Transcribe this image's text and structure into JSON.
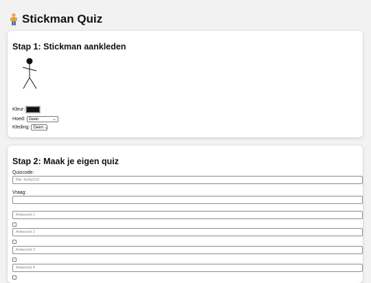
{
  "header": {
    "title": "Stickman Quiz",
    "icon": "person-icon"
  },
  "step1": {
    "title": "Stap 1: Stickman aankleden",
    "color_label": "Kleur:",
    "color_value": "#111111",
    "hat_label": "Hoed:",
    "hat_value": "Geen",
    "clothing_label": "Kleding:",
    "clothing_value": "Geen"
  },
  "step2": {
    "title": "Stap 2: Maak je eigen quiz",
    "quizcode_label": "Quizcode:",
    "quizcode_placeholder": "Bijv. bonty123",
    "question_label": "Vraag:",
    "question_placeholder": "",
    "answers": [
      {
        "placeholder": "Antwoord 1"
      },
      {
        "placeholder": "Antwoord 2"
      },
      {
        "placeholder": "Antwoord 3"
      },
      {
        "placeholder": "Antwoord 4"
      }
    ]
  }
}
